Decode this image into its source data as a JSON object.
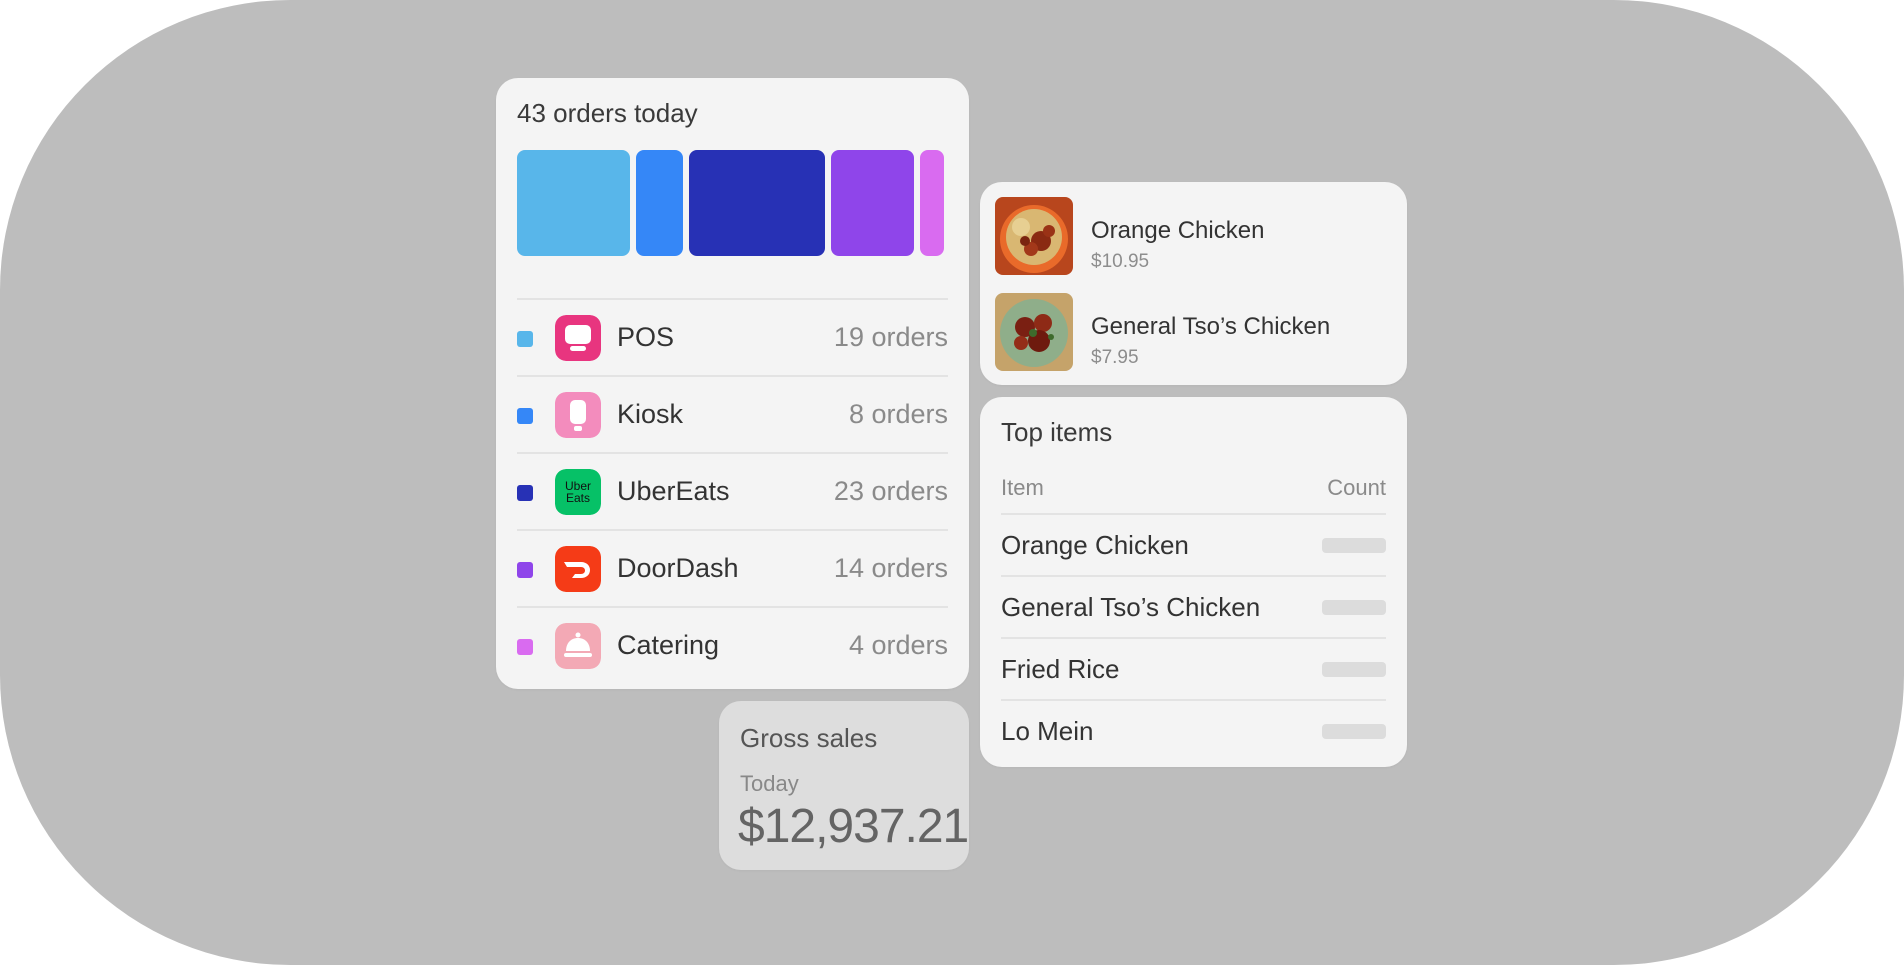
{
  "orders": {
    "title": "43 orders today",
    "distribution": [
      {
        "channel": "POS",
        "orders": 19,
        "color": "#58b6ea"
      },
      {
        "channel": "Kiosk",
        "orders": 8,
        "color": "#3587f7"
      },
      {
        "channel": "UberEats",
        "orders": 23,
        "color": "#2731b5"
      },
      {
        "channel": "DoorDash",
        "orders": 14,
        "color": "#8f45ea"
      },
      {
        "channel": "Catering",
        "orders": 4,
        "color": "#d96bf0"
      }
    ],
    "channels": [
      {
        "name": "POS",
        "count": "19 orders",
        "dot_color": "#58b6ea",
        "icon": "pos-terminal-icon",
        "icon_bg": "#e8357f"
      },
      {
        "name": "Kiosk",
        "count": "8 orders",
        "dot_color": "#3587f7",
        "icon": "kiosk-icon",
        "icon_bg": "#f38cbd"
      },
      {
        "name": "UberEats",
        "count": "23 orders",
        "dot_color": "#2731b5",
        "icon": "ubereats-logo-icon",
        "icon_bg": "#06c167",
        "icon_text_1": "Uber",
        "icon_text_2": "Eats"
      },
      {
        "name": "DoorDash",
        "count": "14 orders",
        "dot_color": "#8f45ea",
        "icon": "doordash-logo-icon",
        "icon_bg": "#f53b17"
      },
      {
        "name": "Catering",
        "count": "4 orders",
        "dot_color": "#d96bf0",
        "icon": "catering-cloche-icon",
        "icon_bg": "#f3a9b5"
      }
    ]
  },
  "gross_sales": {
    "title": "Gross sales",
    "period": "Today",
    "amount": "$12,937.21"
  },
  "menu_items": [
    {
      "name": "Orange Chicken",
      "price": "$10.95",
      "image": "orange-chicken-photo"
    },
    {
      "name": "General Tso’s Chicken",
      "price": "$7.95",
      "image": "general-tsos-chicken-photo"
    }
  ],
  "top_items": {
    "title": "Top items",
    "col_item": "Item",
    "col_count": "Count",
    "rows": [
      {
        "name": "Orange Chicken"
      },
      {
        "name": "General Tso’s Chicken"
      },
      {
        "name": "Fried Rice"
      },
      {
        "name": "Lo Mein"
      }
    ]
  }
}
